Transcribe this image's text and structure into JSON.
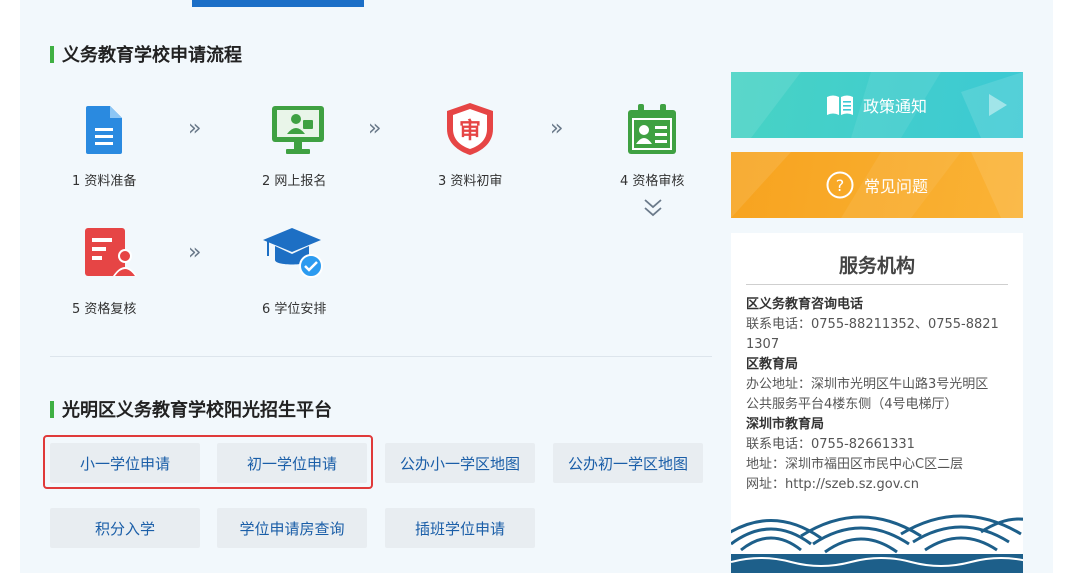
{
  "section1": {
    "title": "义务教育学校申请流程"
  },
  "steps": [
    {
      "label": "1 资料准备",
      "icon": "document-icon"
    },
    {
      "label": "2 网上报名",
      "icon": "online-register-icon"
    },
    {
      "label": "3 资料初审",
      "icon": "review-shield-icon"
    },
    {
      "label": "4 资格审核",
      "icon": "id-card-icon"
    },
    {
      "label": "5 资格复核",
      "icon": "recheck-icon"
    },
    {
      "label": "6 学位安排",
      "icon": "graduation-cap-icon"
    }
  ],
  "section2": {
    "title": "光明区义务教育学校阳光招生平台"
  },
  "buttons": [
    "小一学位申请",
    "初一学位申请",
    "公办小一学区地图",
    "公办初一学区地图",
    "积分入学",
    "学位申请房查询",
    "插班学位申请"
  ],
  "banners": {
    "policy": "政策通知",
    "faq": "常见问题"
  },
  "service": {
    "title": "服务机构",
    "lines": [
      "区义务教育咨询电话",
      "联系电话：0755-88211352、0755-8821",
      "1307",
      "区教育局",
      "办公地址：深圳市光明区牛山路3号光明区",
      "公共服务平台4楼东侧（4号电梯厅）",
      "深圳市教育局",
      "联系电话：0755-82661331",
      "地址：深圳市福田区市民中心C区二层",
      "网址：http://szeb.sz.gov.cn"
    ]
  },
  "colors": {
    "accent_green": "#3fb043",
    "link_blue": "#1a5ea8",
    "banner_teal": "#3dcfc9",
    "banner_orange": "#f7a622",
    "highlight_red": "#e03a3a"
  }
}
